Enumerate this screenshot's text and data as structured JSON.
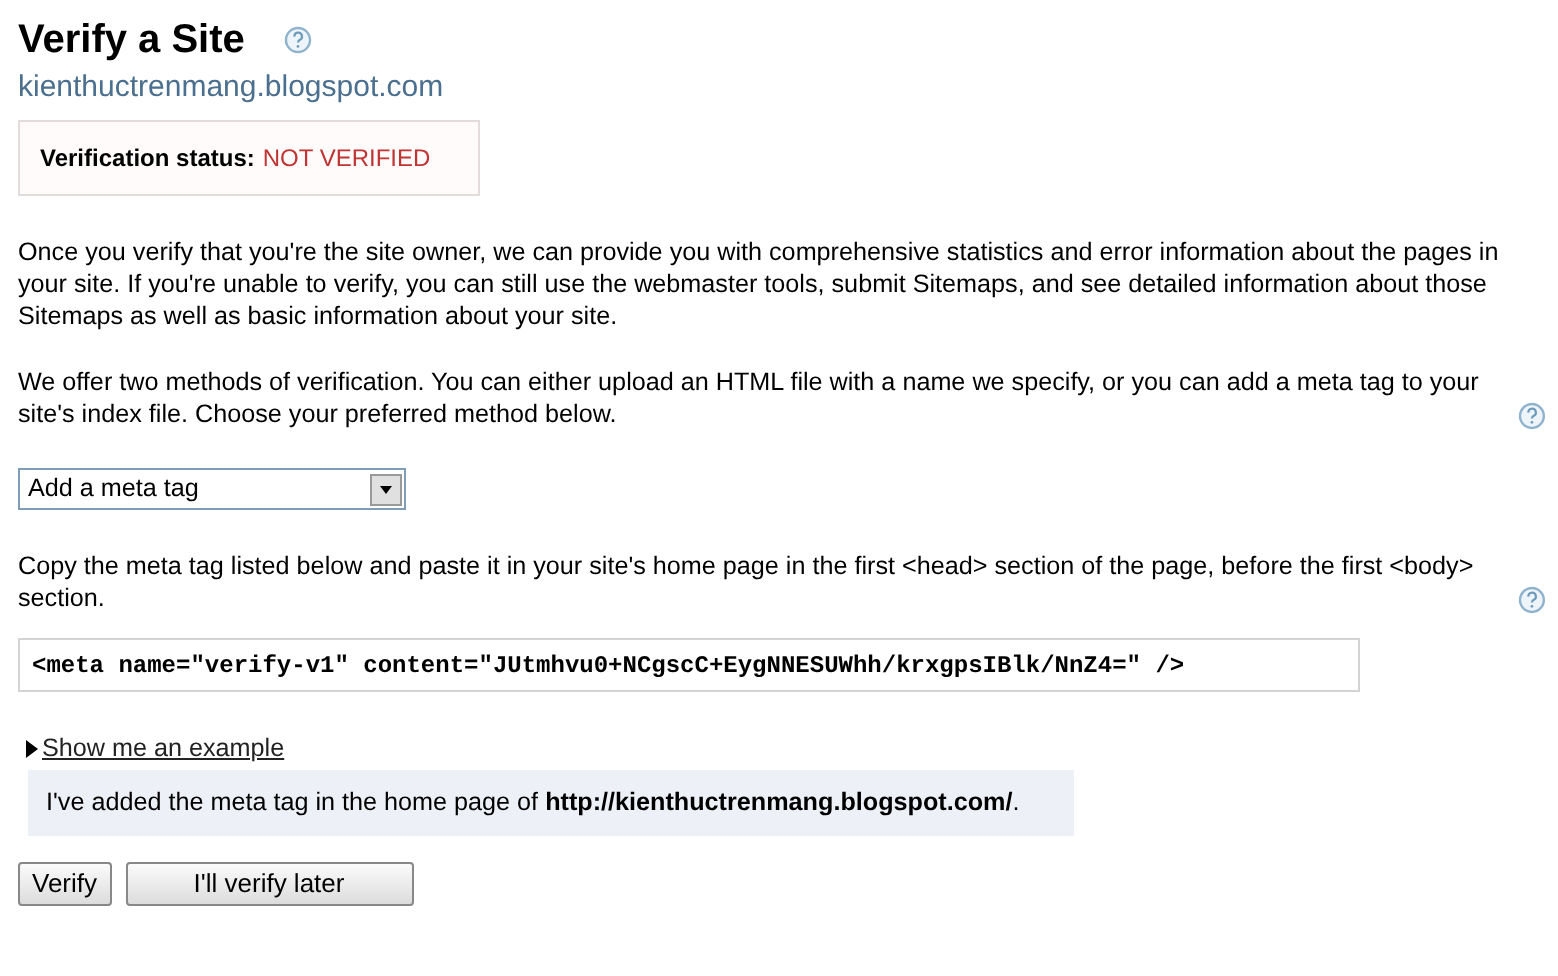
{
  "title": "Verify a Site",
  "site": "kienthuctrenmang.blogspot.com",
  "status": {
    "label": "Verification status:",
    "value": "NOT VERIFIED"
  },
  "intro": "Once you verify that you're the site owner, we can provide you with comprehensive statistics and error information about the pages in your site. If you're unable to verify, you can still use the webmaster tools, submit Sitemaps, and see detailed information about those Sitemaps as well as basic information about your site.",
  "methods_text": "We offer two methods of verification. You can either upload an HTML file with a name we specify, or you can add a meta tag to your site's index file. Choose your preferred method below.",
  "method_select": {
    "value": "Add a meta tag"
  },
  "copy_text": "Copy the meta tag listed below and paste it in your site's home page in the first <head> section of the page, before the first <body> section.",
  "meta_tag": "<meta name=\"verify-v1\" content=\"JUtmhvu0+NCgscC+EygNNESUWhh/krxgpsIBlk/NnZ4=\" />",
  "example_link": {
    "label": "Show me an example",
    "expanded": false
  },
  "confirmation": "I've added the meta tag in the home page of **http://kienthuctrenmang.blogspot.com/**.",
  "buttons": [
    "Verify",
    "I'll verify later"
  ]
}
